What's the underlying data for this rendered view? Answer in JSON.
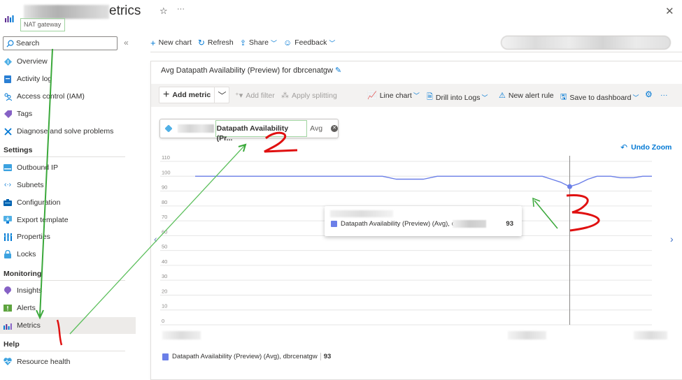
{
  "header": {
    "title_suffix": "etrics",
    "resource_type": "NAT gateway",
    "star_icon": "☆",
    "more_icon": "···",
    "close_icon": "✕"
  },
  "sidebar": {
    "search_placeholder": "Search",
    "collapse_icon": "«",
    "items": [
      {
        "label": "Overview",
        "icon": "overview-icon"
      },
      {
        "label": "Activity log",
        "icon": "activity-log-icon"
      },
      {
        "label": "Access control (IAM)",
        "icon": "iam-icon"
      },
      {
        "label": "Tags",
        "icon": "tag-icon"
      },
      {
        "label": "Diagnose and solve problems",
        "icon": "wrench-icon"
      }
    ],
    "sections": [
      {
        "title": "Settings",
        "items": [
          {
            "label": "Outbound IP",
            "icon": "outbound-ip-icon"
          },
          {
            "label": "Subnets",
            "icon": "subnets-icon"
          },
          {
            "label": "Configuration",
            "icon": "configuration-icon"
          },
          {
            "label": "Export template",
            "icon": "export-template-icon"
          },
          {
            "label": "Properties",
            "icon": "properties-icon"
          },
          {
            "label": "Locks",
            "icon": "lock-icon"
          }
        ]
      },
      {
        "title": "Monitoring",
        "items": [
          {
            "label": "Insights",
            "icon": "insights-icon"
          },
          {
            "label": "Alerts",
            "icon": "alerts-icon"
          },
          {
            "label": "Metrics",
            "icon": "metrics-icon",
            "active": true
          }
        ]
      },
      {
        "title": "Help",
        "items": [
          {
            "label": "Resource health",
            "icon": "heart-icon"
          }
        ]
      }
    ]
  },
  "commandbar": {
    "new_chart": "New chart",
    "refresh": "Refresh",
    "share": "Share",
    "feedback": "Feedback"
  },
  "chart_card": {
    "title": "Avg Datapath Availability (Preview) for dbrcenatgw",
    "toolbar": {
      "add_metric": "Add metric",
      "add_filter": "Add filter",
      "apply_splitting": "Apply splitting",
      "line_chart": "Line chart",
      "drill_into_logs": "Drill into Logs",
      "new_alert_rule": "New alert rule",
      "save_to_dashboard": "Save to dashboard"
    },
    "metric_pill": {
      "metric_name": "Datapath Availability (Pr...",
      "aggregation": "Avg",
      "remove_icon": "✕"
    },
    "undo_zoom": "Undo Zoom",
    "tooltip": {
      "label": "Datapath Availability (Preview) (Avg), c",
      "value": "93"
    },
    "legend": {
      "label": "Datapath Availability (Preview) (Avg), dbrcenatgw",
      "value": "93"
    },
    "series_color": "#6b7fe8"
  },
  "chart_data": {
    "type": "line",
    "title": "Avg Datapath Availability (Preview) for dbrcenatgw",
    "xlabel": "",
    "ylabel": "",
    "ylim": [
      0,
      110
    ],
    "yticks": [
      0,
      10,
      20,
      30,
      40,
      50,
      60,
      70,
      80,
      90,
      100,
      110
    ],
    "grid": true,
    "series": [
      {
        "name": "Datapath Availability (Preview) (Avg), dbrcenatgw",
        "x": [
          0,
          0.41,
          0.44,
          0.47,
          0.5,
          0.53,
          0.76,
          0.78,
          0.8,
          0.82,
          0.84,
          0.86,
          0.88,
          0.91,
          1.0
        ],
        "y": [
          100,
          100,
          98,
          98,
          98,
          100,
          100,
          98,
          96,
          93,
          95,
          98,
          100,
          100,
          100
        ]
      }
    ],
    "x_dip2": {
      "x": [
        0.91,
        0.93,
        0.96,
        0.98
      ],
      "y": [
        100,
        99,
        99,
        100
      ]
    },
    "highlight": {
      "x": 0.82,
      "y": 93
    }
  },
  "annotations": {
    "labels": [
      "1",
      "2",
      "3"
    ]
  }
}
